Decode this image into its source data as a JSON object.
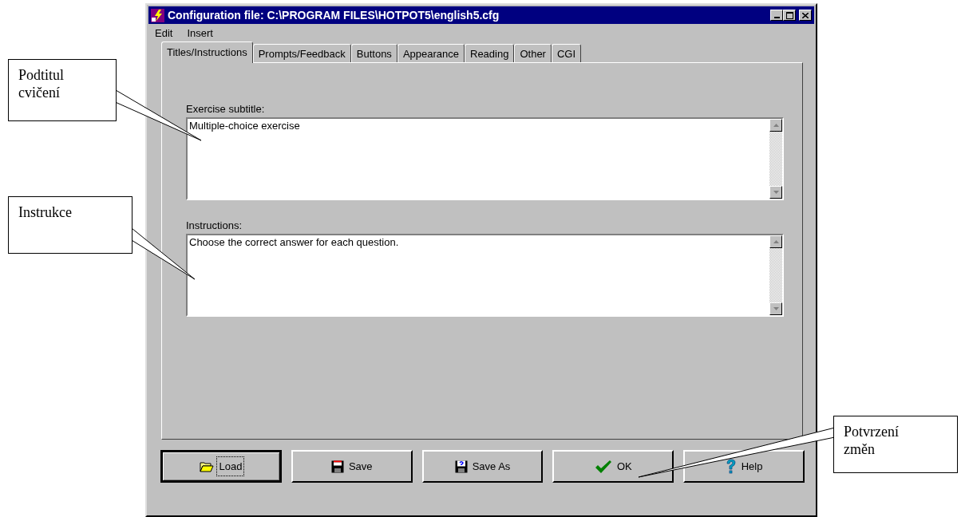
{
  "window": {
    "title": "Configuration file: C:\\PROGRAM FILES\\HOTPOT5\\english5.cfg"
  },
  "menu": [
    "Edit",
    "Insert"
  ],
  "tabs": [
    {
      "label": "Titles/Instructions",
      "selected": true
    },
    {
      "label": "Prompts/Feedback",
      "selected": false
    },
    {
      "label": "Buttons",
      "selected": false
    },
    {
      "label": "Appearance",
      "selected": false
    },
    {
      "label": "Reading",
      "selected": false
    },
    {
      "label": "Other",
      "selected": false
    },
    {
      "label": "CGI",
      "selected": false
    }
  ],
  "fields": [
    {
      "label": "Exercise subtitle:",
      "value": "Multiple-choice exercise"
    },
    {
      "label": "Instructions:",
      "value": "Choose the correct answer for each question."
    }
  ],
  "buttons": [
    {
      "label": "Load",
      "kind": "open",
      "focused": true
    },
    {
      "label": "Save",
      "kind": "save",
      "focused": false
    },
    {
      "label": "Save As",
      "kind": "saveas",
      "focused": false
    },
    {
      "label": "OK",
      "kind": "ok",
      "focused": false
    },
    {
      "label": "Help",
      "kind": "help",
      "focused": false
    }
  ],
  "callouts": [
    {
      "lines": [
        "Podtitul",
        "cvičení"
      ]
    },
    {
      "lines": [
        "Instrukce"
      ]
    },
    {
      "lines": [
        "Potvrzení",
        "změn"
      ]
    }
  ]
}
